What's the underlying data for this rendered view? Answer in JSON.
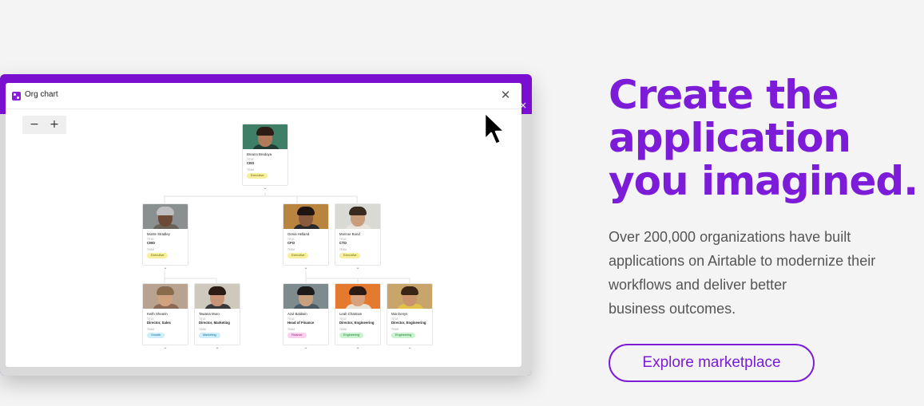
{
  "modal": {
    "title": "Org chart",
    "close_glyph": "✕",
    "zoom_out": "−",
    "zoom_in": "+"
  },
  "org": {
    "labels": {
      "title": "TITLE",
      "team": "TEAM"
    },
    "people": [
      {
        "name": "Breann Bredoya",
        "title": "CEO",
        "team": "Executive",
        "badge_bg": "#f6ef9e",
        "badge_fg": "#6b6200",
        "photo_bg": "#3f7f67",
        "skin": "#b07a5b",
        "hair": "#2b1d14",
        "body": "#1f3d33"
      },
      {
        "name": "Monte Stradley",
        "title": "CMO",
        "team": "Executive",
        "badge_bg": "#f6ef9e",
        "badge_fg": "#6b6200",
        "photo_bg": "#8c8f8f",
        "skin": "#6d4a35",
        "hair": "#bfbfbf",
        "body": "#6a6258"
      },
      {
        "name": "Genia Helland",
        "title": "CFO",
        "team": "Executive",
        "badge_bg": "#f6ef9e",
        "badge_fg": "#6b6200",
        "photo_bg": "#b9843e",
        "skin": "#8a5a3e",
        "hair": "#1f140f",
        "body": "#2a2a2a"
      },
      {
        "name": "Monroe Bond",
        "title": "CTO",
        "team": "Executive",
        "badge_bg": "#f6ef9e",
        "badge_fg": "#6b6200",
        "photo_bg": "#d9d9d6",
        "skin": "#c99c7b",
        "hair": "#3b2a20",
        "body": "#e8e4dc"
      },
      {
        "name": "Keith Shearin",
        "title": "Director, Sales",
        "team": "Growth",
        "badge_bg": "#cdeefa",
        "badge_fg": "#1f6c8a",
        "photo_bg": "#b7a38f",
        "skin": "#d1a27e",
        "hair": "#8a6b4c",
        "body": "#8c6a56"
      },
      {
        "name": "Tawana Muro",
        "title": "Director, Marketing",
        "team": "Marketing",
        "badge_bg": "#cdeefa",
        "badge_fg": "#1f6c8a",
        "photo_bg": "#cfc8bd",
        "skin": "#c89478",
        "hair": "#2a1c15",
        "body": "#3a3a3a"
      },
      {
        "name": "Azul Baldwin",
        "title": "Head of Finance",
        "team": "Finance",
        "badge_bg": "#fbd0ee",
        "badge_fg": "#8a1f6f",
        "photo_bg": "#7d8a8e",
        "skin": "#c8a07e",
        "hair": "#1b1b1b",
        "body": "#4b5b66"
      },
      {
        "name": "Leah Chatman",
        "title": "Director, Engineering",
        "team": "Engineering",
        "badge_bg": "#c9f2cf",
        "badge_fg": "#1f7a33",
        "photo_bg": "#e57a2f",
        "skin": "#d6a17c",
        "hair": "#2b1a12",
        "body": "#e9e1d4"
      },
      {
        "name": "Mia Denys",
        "title": "Director, Engineering",
        "team": "Engineering",
        "badge_bg": "#c9f2cf",
        "badge_fg": "#1f7a33",
        "photo_bg": "#c8a56b",
        "skin": "#c9946c",
        "hair": "#3a2416",
        "body": "#e3c24a"
      }
    ]
  },
  "hero": {
    "headline_lines": [
      "Create the",
      "application",
      "you imagined."
    ],
    "body_lines": [
      "Over 200,000 organizations have built",
      "applications on Airtable to modernize their",
      "workflows and deliver better",
      "business outcomes."
    ],
    "cta_label": "Explore marketplace"
  },
  "colors": {
    "brand_purple": "#7c1bd8",
    "frame_purple": "#7b0fd0",
    "page_bg": "#f4f4f4"
  },
  "icons": [
    "org-chart-app-icon",
    "close-icon",
    "zoom-out-icon",
    "zoom-in-icon",
    "mouse-pointer-icon",
    "chevron-down-icon"
  ]
}
